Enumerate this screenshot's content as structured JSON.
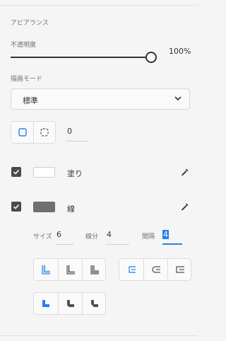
{
  "section_title": "アピアランス",
  "opacity": {
    "label": "不透明度",
    "value_text": "100%",
    "value": 100
  },
  "blend_mode": {
    "label": "描画モード",
    "selected": "標準"
  },
  "corner_radius": {
    "value": "0"
  },
  "fill": {
    "label": "塗り",
    "checked": true,
    "color": "#ffffff"
  },
  "stroke": {
    "label": "線",
    "checked": true,
    "color": "#707070"
  },
  "stroke_options": {
    "size_label": "サイズ",
    "size_value": "6",
    "dash_label": "線分",
    "dash_value": "4",
    "gap_label": "間隔",
    "gap_value": "4"
  },
  "colors": {
    "accent": "#2680eb",
    "text": "#323232",
    "border": "#dcdcdc"
  },
  "icons": {
    "eyedropper": "eyedropper-icon",
    "chevron": "chevron-down-icon",
    "corner_all": "corner-all-icon",
    "corner_individual": "corner-individual-icon"
  }
}
